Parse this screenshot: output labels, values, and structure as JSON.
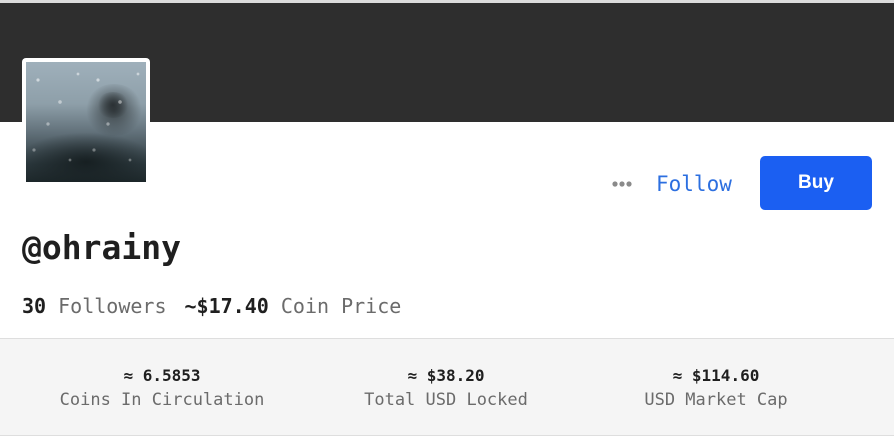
{
  "profile": {
    "handle": "@ohrainy",
    "avatar_icon": "rainy-window-photo"
  },
  "actions": {
    "more_icon": "ellipsis-icon",
    "follow_label": "Follow",
    "buy_label": "Buy"
  },
  "stats": {
    "followers_count": "30",
    "followers_label": "Followers",
    "coin_price": "~$17.40",
    "coin_price_label": "Coin Price"
  },
  "metrics": [
    {
      "value": "≈ 6.5853",
      "label": "Coins In Circulation"
    },
    {
      "value": "≈ $38.20",
      "label": "Total USD Locked"
    },
    {
      "value": "≈ $114.60",
      "label": "USD Market Cap"
    }
  ],
  "colors": {
    "banner": "#2e2e2e",
    "accent": "#1b5ff2",
    "link": "#2c6fe0",
    "muted_text": "#6b6b6b"
  }
}
